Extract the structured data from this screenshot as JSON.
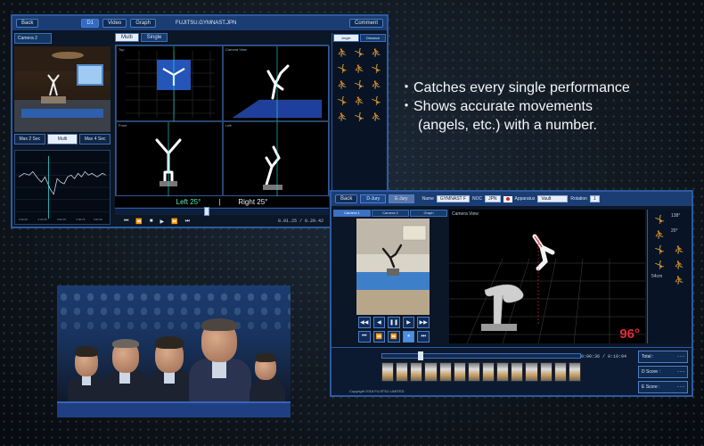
{
  "bullets": [
    "・Catches every single performance",
    "・Shows accurate movements",
    "(angels, etc.) with a number."
  ],
  "panel1": {
    "back_label": "Back",
    "tab_labels": [
      "D1",
      "Video",
      "Graph"
    ],
    "gymnast_id": "FUJITSU.GYMNAST.JPN",
    "comment_label": "Comment",
    "camera_label": "Camera 2",
    "toggles": [
      "Max 2 Sec",
      "Multi",
      "Max 4 Sec"
    ],
    "view_tabs": [
      "Multi",
      "Single"
    ],
    "view_labels": [
      "Top",
      "Camera View",
      "Front",
      "Left"
    ],
    "angle_left": "Left 25°",
    "angle_sep": "|",
    "angle_right": "Right 25°",
    "time_readout": "0.01.25 / 0.20.42",
    "side_tabs": [
      "Angle",
      "Distance"
    ],
    "graph_ticks": [
      "0.00.00",
      "0.00.05",
      "0.00.10",
      "0.00.15",
      "0.00.20"
    ]
  },
  "panel2": {
    "back_label": "Back",
    "jury_label": "D-Jury",
    "ejury_label": "E-Jury",
    "name_label": "Name",
    "name_value": "GYMNAST F",
    "noc_label": "NOC",
    "noc_value": "JPN",
    "apparatus_label": "Apparatus",
    "apparatus_value": "Vault",
    "rotation_label": "Rotation",
    "rotation_value": "1",
    "cam_tabs": [
      "Camera 1",
      "Camera 2",
      "Graph"
    ],
    "view_label": "Camera View",
    "angle": "96°",
    "timer": "0:00:36 / 0:10:94",
    "copyright": "Copyright 2018 FUJITSU LIMITED",
    "scores": [
      {
        "label": "Total :",
        "value": "- - -"
      },
      {
        "label": "D Score :",
        "value": "- - -"
      },
      {
        "label": "E Score :",
        "value": "- - -"
      }
    ],
    "side_angles": [
      "138°",
      "20°",
      "54cm"
    ]
  },
  "colors": {
    "accent": "#2c5aa0",
    "angle_red": "#e02a38",
    "angle_green": "#5ee8b8"
  }
}
